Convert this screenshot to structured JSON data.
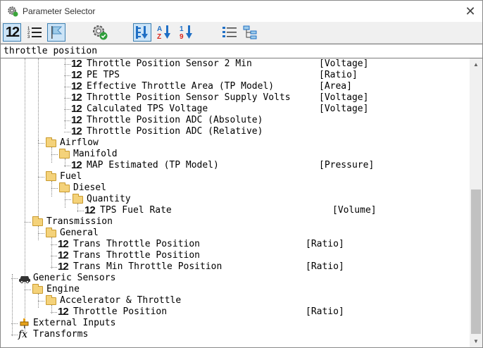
{
  "window": {
    "title": "Parameter Selector",
    "close_glyph": "✕"
  },
  "toolbar": {
    "buttons": [
      {
        "name": "numeric-view-icon",
        "glyph": "12"
      },
      {
        "name": "list-view-icon",
        "glyph": ""
      },
      {
        "name": "flag-icon",
        "glyph": ""
      },
      {
        "name": "gear-check-icon",
        "glyph": ""
      },
      {
        "name": "expand-sort-icon",
        "glyph": ""
      },
      {
        "name": "sort-az-icon",
        "glyph": ""
      },
      {
        "name": "sort-19-icon",
        "glyph": ""
      },
      {
        "name": "list-tree-icon",
        "glyph": ""
      },
      {
        "name": "hierarchy-icon",
        "glyph": ""
      }
    ],
    "sort_az_top": "A",
    "sort_az_bottom": "Z",
    "sort_19_top": "1",
    "sort_19_bottom": "9"
  },
  "search": {
    "value": "throttle position",
    "placeholder": ""
  },
  "tree": {
    "items": [
      {
        "label": "Throttle Position Sensor 2 Min",
        "unit": "[Voltage]",
        "type": "param"
      },
      {
        "label": "PE TPS",
        "unit": "[Ratio]",
        "type": "param"
      },
      {
        "label": "Effective Throttle Area (TP Model)",
        "unit": "[Area]",
        "type": "param"
      },
      {
        "label": "Throttle Position Sensor Supply Volts",
        "unit": "[Voltage]",
        "type": "param"
      },
      {
        "label": "Calculated TPS Voltage",
        "unit": "[Voltage]",
        "type": "param"
      },
      {
        "label": "Throttle Position ADC (Absolute)",
        "unit": "",
        "type": "param"
      },
      {
        "label": "Throttle Position ADC (Relative)",
        "unit": "",
        "type": "param"
      },
      {
        "label": "Airflow",
        "unit": "",
        "type": "folder"
      },
      {
        "label": "Manifold",
        "unit": "",
        "type": "folder"
      },
      {
        "label": "MAP Estimated (TP Model)",
        "unit": "[Pressure]",
        "type": "param"
      },
      {
        "label": "Fuel",
        "unit": "",
        "type": "folder"
      },
      {
        "label": "Diesel",
        "unit": "",
        "type": "folder"
      },
      {
        "label": "Quantity",
        "unit": "",
        "type": "folder"
      },
      {
        "label": "TPS Fuel Rate",
        "unit": "[Volume]",
        "type": "param"
      },
      {
        "label": "Transmission",
        "unit": "",
        "type": "folder"
      },
      {
        "label": "General",
        "unit": "",
        "type": "folder"
      },
      {
        "label": "Trans Throttle Position",
        "unit": "[Ratio]",
        "type": "param"
      },
      {
        "label": "Trans Throttle Position",
        "unit": "",
        "type": "param"
      },
      {
        "label": "Trans Min Throttle Position",
        "unit": "[Ratio]",
        "type": "param"
      },
      {
        "label": "Generic Sensors",
        "unit": "",
        "type": "car"
      },
      {
        "label": "Engine",
        "unit": "",
        "type": "folder"
      },
      {
        "label": "Accelerator & Throttle",
        "unit": "",
        "type": "folder"
      },
      {
        "label": "Throttle Position",
        "unit": "[Ratio]",
        "type": "param"
      },
      {
        "label": "External Inputs",
        "unit": "",
        "type": "plug"
      },
      {
        "label": "Transforms",
        "unit": "",
        "type": "fx"
      }
    ],
    "param_icon_glyph": "12",
    "fx_glyph": "fx"
  },
  "scrollbar": {
    "up_glyph": "▲",
    "down_glyph": "▼"
  },
  "colors": {
    "accent": "#3c7fb1",
    "folder": "#f4d27a",
    "sort_red": "#d9261c",
    "sort_blue": "#1f6fc5"
  }
}
